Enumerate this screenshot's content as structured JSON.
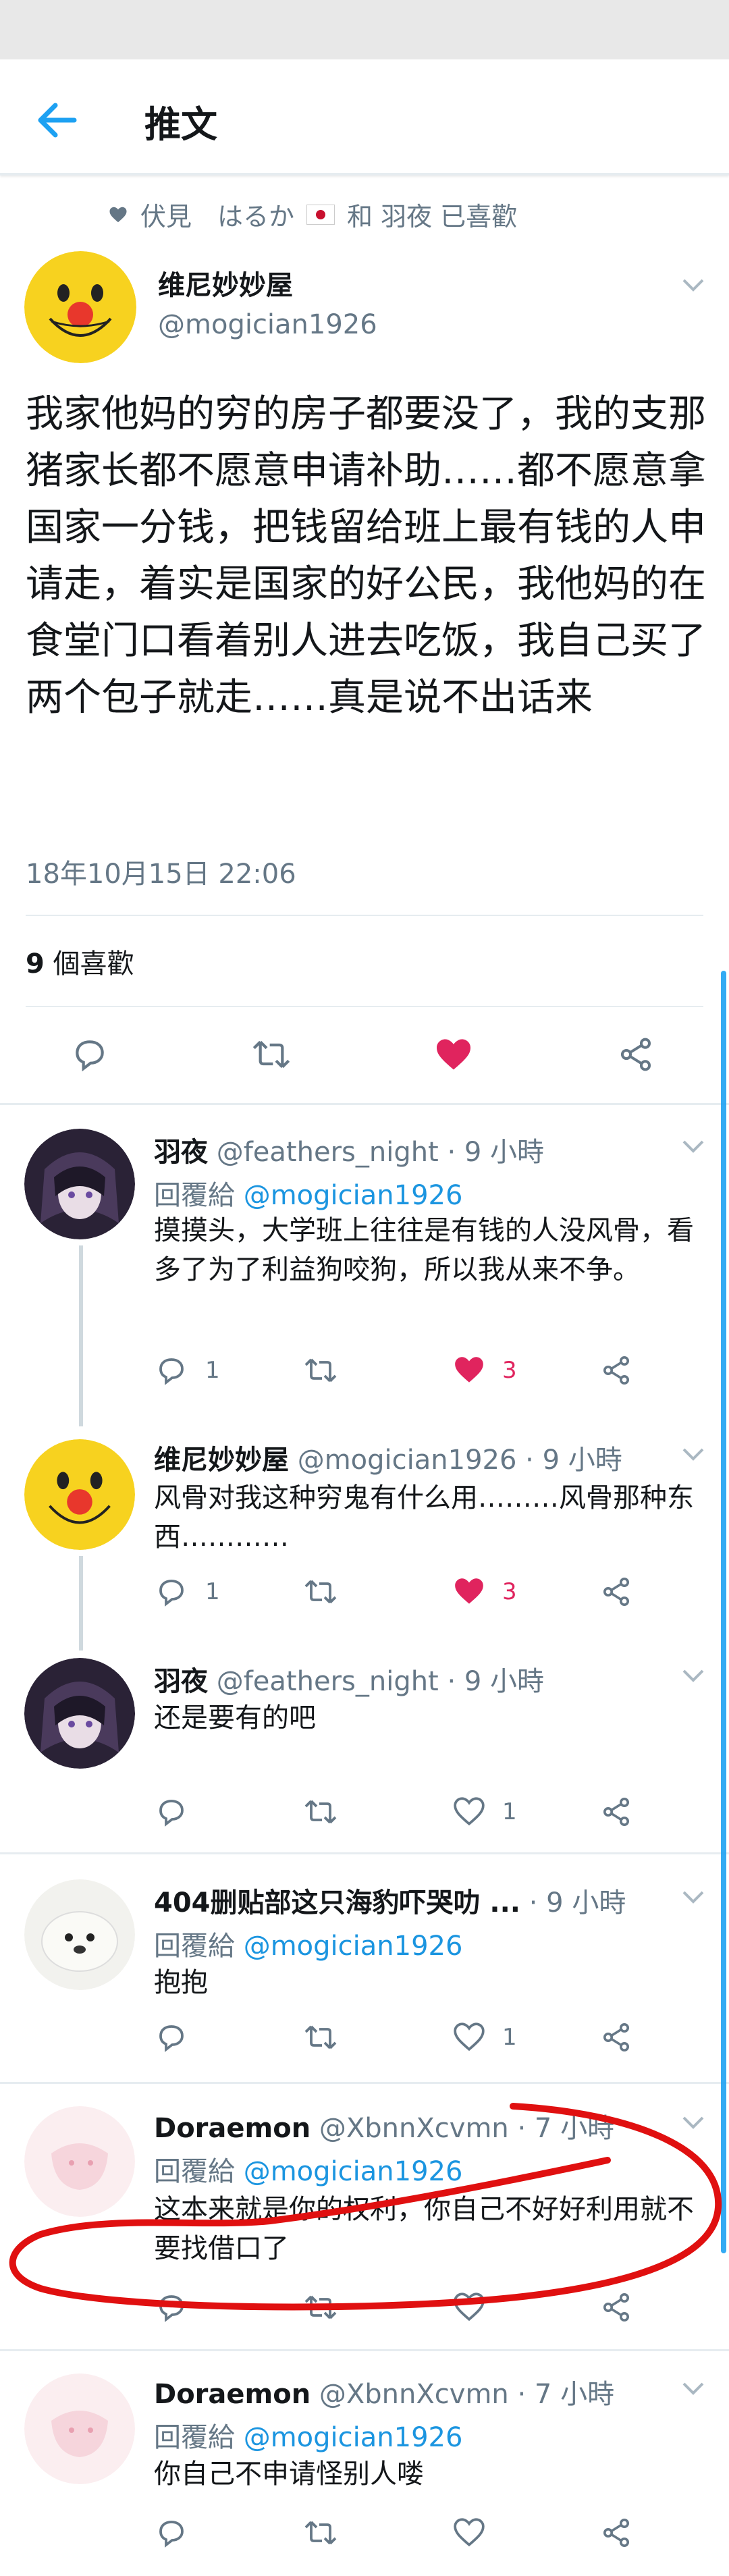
{
  "header": {
    "title": "推文"
  },
  "liked_by": {
    "text_pre": "伏見　はるか",
    "text_post": "和 羽夜 已喜歡"
  },
  "tweet": {
    "name": "维尼妙妙屋",
    "handle": "@mogician1926",
    "text": "我家他妈的穷的房子都要没了，我的支那猪家长都不愿意申请补助……都不愿意拿国家一分钱，把钱留给班上最有钱的人申请走，着实是国家的好公民，我他妈的在食堂门口看着别人进去吃饭，我自己买了两个包子就走……真是说不出话来",
    "timestamp": "18年10月15日 22:06",
    "likes_count": "9",
    "likes_label": " 個喜歡"
  },
  "replies": [
    {
      "name": "羽夜",
      "meta": "@feathers_night · 9 小時",
      "replying_label": "回覆給 ",
      "replying_to": "@mogician1926",
      "text": "摸摸头，大学班上往往是有钱的人没风骨，看多了为了利益狗咬狗，所以我从来不争。",
      "reply_count": "1",
      "like_count": "3"
    },
    {
      "name": "维尼妙妙屋",
      "meta": "@mogician1926 · 9 小時",
      "text": "风骨对我这种穷鬼有什么用………风骨那种东西…………",
      "reply_count": "1",
      "like_count": "3"
    },
    {
      "name": "羽夜",
      "meta": "@feathers_night · 9 小時",
      "text": "还是要有的吧",
      "like_count": "1"
    },
    {
      "name": "404删贴部这只海豹吓哭叻 ...",
      "meta": " · 9 小時",
      "replying_label": "回覆給 ",
      "replying_to": "@mogician1926",
      "text": "抱抱",
      "like_count": "1"
    },
    {
      "name": "Doraemon",
      "meta": "@XbnnXcvmn · 7 小時",
      "replying_label": "回覆給 ",
      "replying_to": "@mogician1926",
      "text": "这本来就是你的权利，你自己不好好利用就不要找借口了"
    },
    {
      "name": "Doraemon",
      "meta": "@XbnnXcvmn · 7 小時",
      "replying_label": "回覆給 ",
      "replying_to": "@mogician1926",
      "text": "你自己不申请怪别人喽"
    }
  ],
  "colors": {
    "accent": "#1da1f2",
    "like_red": "#e0245e",
    "muted": "#657786",
    "annotation_red": "#e01010"
  },
  "icons": [
    "back-arrow-icon",
    "heart-icon",
    "reply-icon",
    "retweet-icon",
    "share-icon",
    "chevron-down-icon"
  ]
}
